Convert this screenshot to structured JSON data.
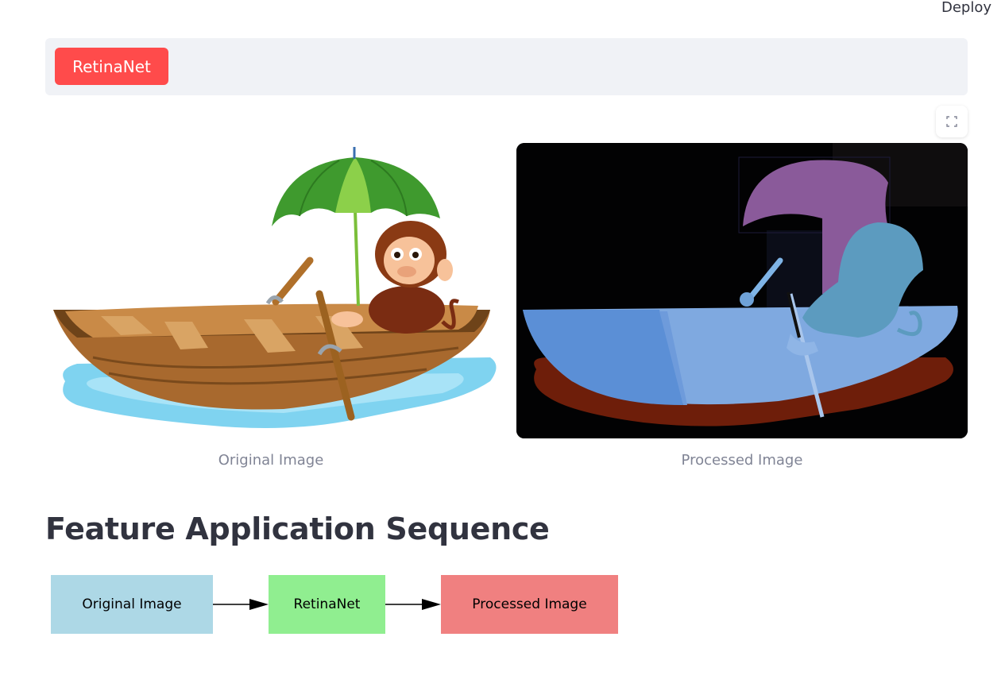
{
  "header": {
    "deploy_label": "Deploy"
  },
  "tabs": [
    {
      "label": "RetinaNet",
      "accent": "#ff4b4b"
    }
  ],
  "toolbar": {
    "fullscreen_icon": "fullscreen-expand-icon"
  },
  "images": {
    "original_caption": "Original Image",
    "processed_caption": "Processed Image"
  },
  "sequence": {
    "title": "Feature Application Sequence",
    "steps": [
      {
        "label": "Original Image",
        "color": "#add8e6"
      },
      {
        "label": "RetinaNet",
        "color": "#90ee90"
      },
      {
        "label": "Processed Image",
        "color": "#f08080"
      }
    ]
  }
}
